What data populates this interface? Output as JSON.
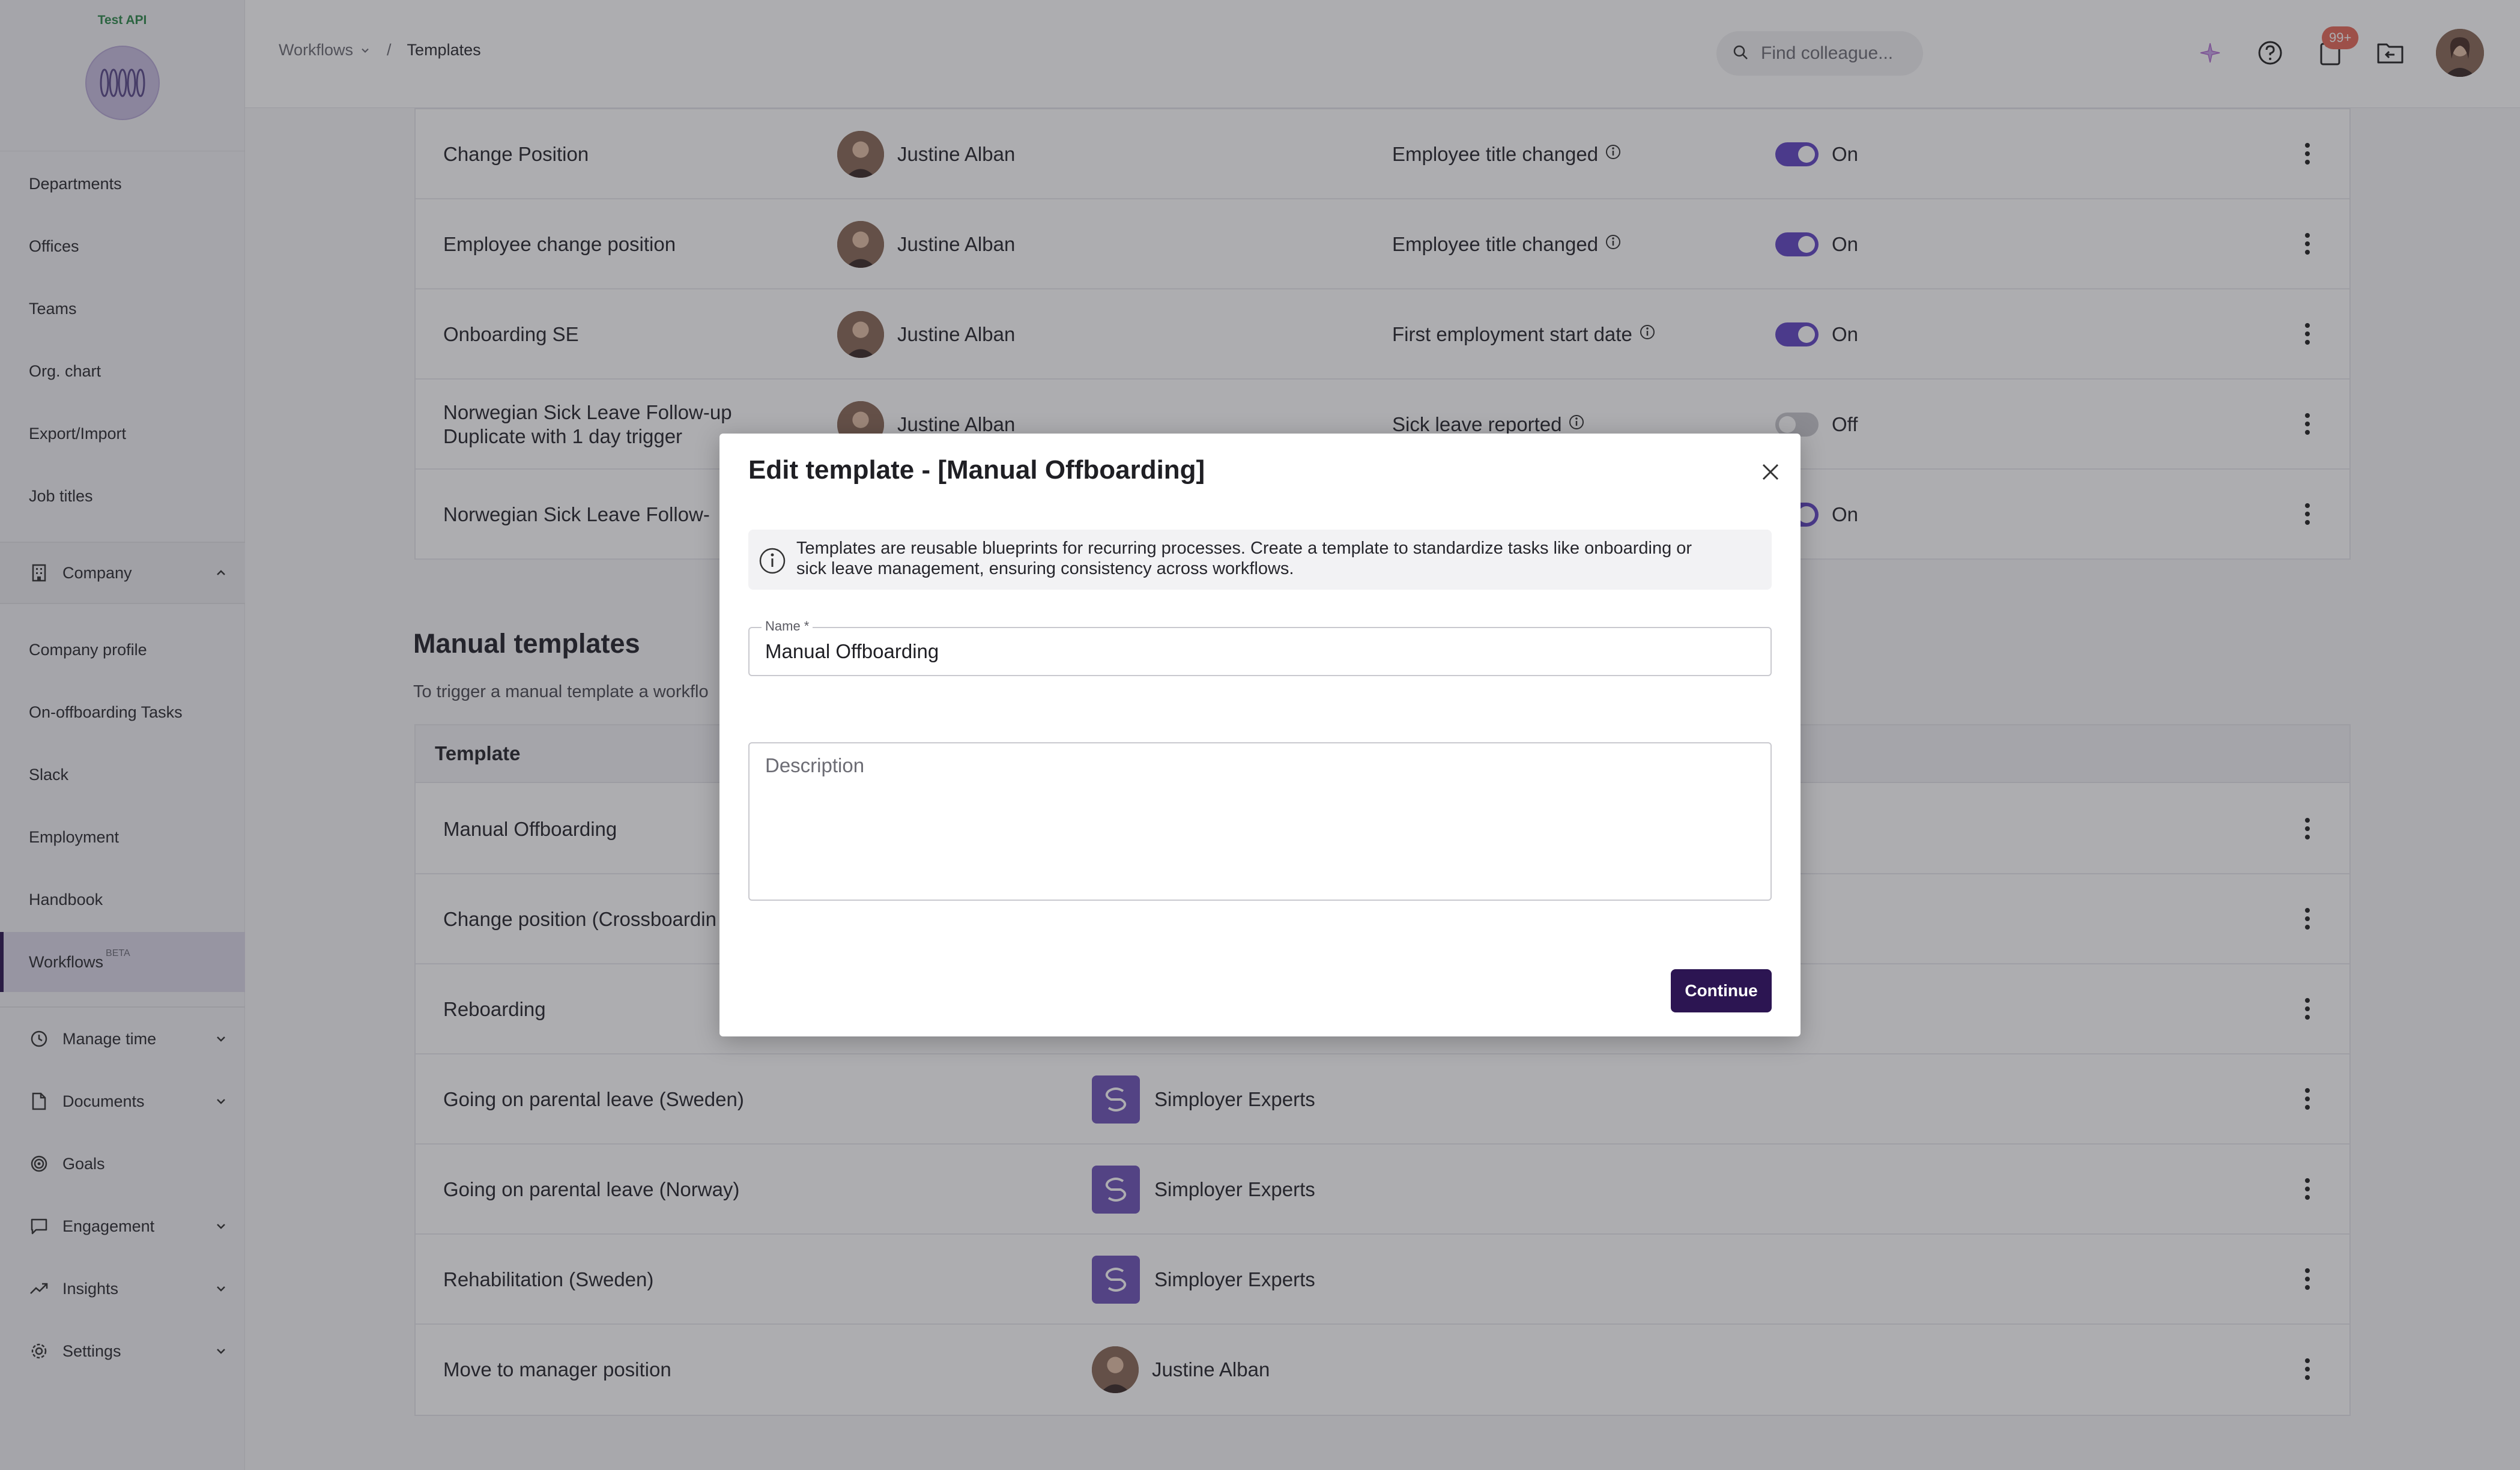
{
  "brand": {
    "name": "Test API"
  },
  "sidebar": {
    "org_items": [
      {
        "label": "Departments"
      },
      {
        "label": "Offices"
      },
      {
        "label": "Teams"
      },
      {
        "label": "Org. chart"
      },
      {
        "label": "Export/Import"
      },
      {
        "label": "Job titles"
      }
    ],
    "company": {
      "label": "Company",
      "icon": "building-icon"
    },
    "company_items": [
      {
        "label": "Company profile"
      },
      {
        "label": "On-offboarding Tasks"
      },
      {
        "label": "Slack"
      },
      {
        "label": "Employment"
      },
      {
        "label": "Handbook"
      },
      {
        "label": "Workflows",
        "badge": "BETA",
        "active": true
      }
    ],
    "sections": [
      {
        "label": "Manage time",
        "icon": "clock-icon"
      },
      {
        "label": "Documents",
        "icon": "document-icon"
      },
      {
        "label": "Goals",
        "icon": "target-icon"
      },
      {
        "label": "Engagement",
        "icon": "chat-icon"
      },
      {
        "label": "Insights",
        "icon": "trend-icon"
      },
      {
        "label": "Settings",
        "icon": "gear-icon"
      }
    ]
  },
  "topbar": {
    "breadcrumb": {
      "parent": "Workflows",
      "current": "Templates"
    },
    "search_placeholder": "Find colleague...",
    "notification_badge": "99+"
  },
  "automated_rows": [
    {
      "name": "Change Position",
      "owner": "Justine Alban",
      "trigger": "Employee title changed",
      "status": "On"
    },
    {
      "name": "Employee change position",
      "owner": "Justine Alban",
      "trigger": "Employee title changed",
      "status": "On"
    },
    {
      "name": "Onboarding SE",
      "owner": "Justine Alban",
      "trigger": "First employment start date",
      "status": "On"
    },
    {
      "name_line1": "Norwegian Sick Leave Follow-up",
      "name_line2": "Duplicate with 1 day trigger",
      "owner": "Justine Alban",
      "trigger": "Sick leave reported",
      "status": "Off"
    },
    {
      "name": "Norwegian Sick Leave Follow-",
      "status": "On"
    }
  ],
  "manual": {
    "title": "Manual templates",
    "description": "To trigger a manual template a workflo",
    "column_template": "Template",
    "rows": [
      {
        "name": "Manual Offboarding"
      },
      {
        "name": "Change position (Crossboardin"
      },
      {
        "name": "Reboarding"
      },
      {
        "name": "Going on parental leave (Sweden)",
        "owner": "Simployer Experts"
      },
      {
        "name": "Going on parental leave (Norway)",
        "owner": "Simployer Experts"
      },
      {
        "name": "Rehabilitation (Sweden)",
        "owner": "Simployer Experts"
      },
      {
        "name": "Move to manager position",
        "owner": "Justine Alban"
      }
    ]
  },
  "modal": {
    "title": "Edit template - [Manual Offboarding]",
    "notice_line1": "Templates are reusable blueprints for recurring processes. Create a template to standardize tasks like onboarding or",
    "notice_line2": "sick leave management, ensuring consistency across workflows.",
    "name_label": "Name *",
    "name_value": "Manual Offboarding",
    "description_placeholder": "Description",
    "continue_label": "Continue"
  },
  "colors": {
    "accent": "#2c1552",
    "toggle_on": "#6246c4",
    "badge": "#e56a5a"
  }
}
